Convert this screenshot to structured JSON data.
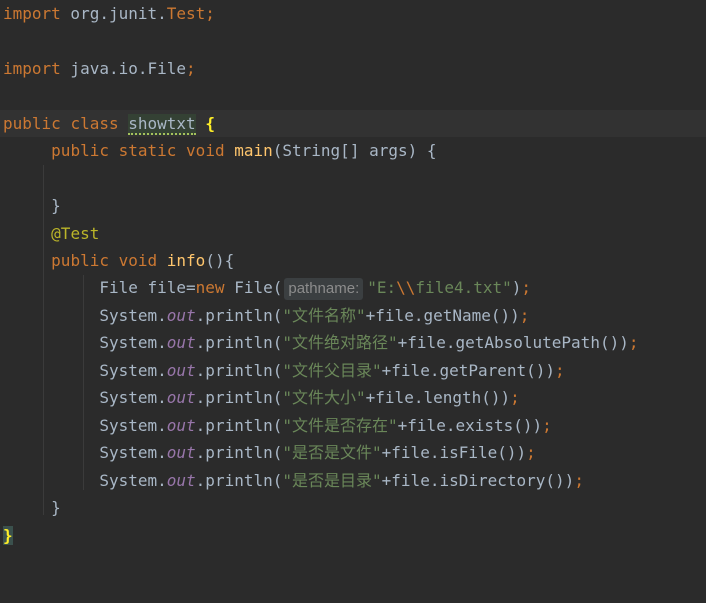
{
  "lines": {
    "l1": {
      "kw": "import",
      "rest": " org.junit.",
      "cls": "Test",
      "semi": ";"
    },
    "l3": {
      "kw": "import",
      "rest": " java.io.File",
      "semi": ";"
    },
    "l5": {
      "kw1": "public",
      "kw2": "class",
      "name": "showtxt",
      "brace": "{"
    },
    "l6": {
      "kw1": "public",
      "kw2": "static",
      "kw3": "void",
      "fn": "main",
      "rest": "(String[] args) {"
    },
    "l8": {
      "brace": "}"
    },
    "l9": {
      "ann": "@Test"
    },
    "l10": {
      "kw1": "public",
      "kw2": "void",
      "fn": "info",
      "rest": "(){"
    },
    "l11": {
      "pre": "File file=",
      "kw": "new",
      "mid": " File(",
      "hint": "pathname:",
      "str1": "\"E:",
      "esc": "\\\\",
      "str2": "file4.txt\"",
      "post": ")",
      "semi": ";"
    },
    "l12": {
      "pre": "System.",
      "fld": "out",
      "mid": ".println(",
      "str": "\"文件名称\"",
      "post": "+file.getName())",
      "semi": ";"
    },
    "l13": {
      "pre": "System.",
      "fld": "out",
      "mid": ".println(",
      "str": "\"文件绝对路径\"",
      "post": "+file.getAbsolutePath())",
      "semi": ";"
    },
    "l14": {
      "pre": "System.",
      "fld": "out",
      "mid": ".println(",
      "str": "\"文件父目录\"",
      "post": "+file.getParent())",
      "semi": ";"
    },
    "l15": {
      "pre": "System.",
      "fld": "out",
      "mid": ".println(",
      "str": "\"文件大小\"",
      "post": "+file.length())",
      "semi": ";"
    },
    "l16": {
      "pre": "System.",
      "fld": "out",
      "mid": ".println(",
      "str": "\"文件是否存在\"",
      "post": "+file.exists())",
      "semi": ";"
    },
    "l17": {
      "pre": "System.",
      "fld": "out",
      "mid": ".println(",
      "str": "\"是否是文件\"",
      "post": "+file.isFile())",
      "semi": ";"
    },
    "l18": {
      "pre": "System.",
      "fld": "out",
      "mid": ".println(",
      "str": "\"是否是目录\"",
      "post": "+file.isDirectory())",
      "semi": ";"
    },
    "l19": {
      "brace": "}"
    },
    "l20": {
      "brace": "}"
    }
  },
  "colors": {
    "background": "#2b2b2b",
    "keyword": "#cc7832",
    "string": "#6a8759",
    "function": "#ffc66d",
    "annotation": "#bbb529",
    "field": "#9876aa",
    "text": "#a9b7c6"
  }
}
